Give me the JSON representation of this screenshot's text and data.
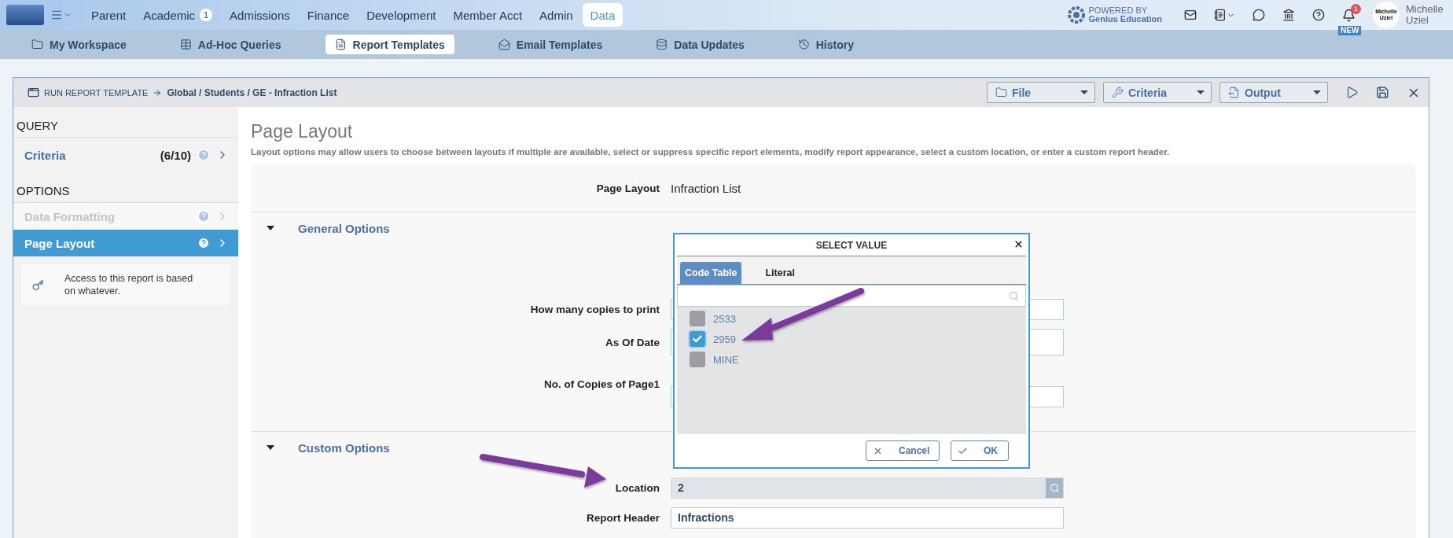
{
  "top_nav": {
    "menu": [
      {
        "label": "Parent",
        "selected": false
      },
      {
        "label": "Academic",
        "badge": "1",
        "selected": false
      },
      {
        "label": "Admissions",
        "selected": false
      },
      {
        "label": "Finance",
        "selected": false
      },
      {
        "label": "Development",
        "selected": false
      },
      {
        "label": "Member Acct",
        "selected": false
      },
      {
        "label": "Admin",
        "selected": false
      },
      {
        "label": "Data",
        "selected": true
      }
    ],
    "powered_by": "POWERED BY",
    "brand": "Genius Education",
    "notification_count": "1",
    "new_badge": "NEW",
    "avatar_lines": [
      "Michelle",
      "Uziel"
    ],
    "user_lines": [
      "Michelle",
      "Uziel"
    ]
  },
  "sub_nav": [
    {
      "label": "My Workspace",
      "selected": false
    },
    {
      "label": "Ad-Hoc Queries",
      "selected": false
    },
    {
      "label": "Report Templates",
      "selected": true
    },
    {
      "label": "Email Templates",
      "selected": false
    },
    {
      "label": "Data Updates",
      "selected": false
    },
    {
      "label": "History",
      "selected": false
    }
  ],
  "panel": {
    "prefix": "RUN REPORT TEMPLATE",
    "path": "Global / Students / GE - Infraction List",
    "menus": [
      {
        "label": "File"
      },
      {
        "label": "Criteria"
      },
      {
        "label": "Output"
      }
    ]
  },
  "sidebar": {
    "sections": [
      {
        "title": "QUERY",
        "items": [
          {
            "label": "Criteria",
            "count": "(6/10)",
            "disabled": false,
            "selected": false
          }
        ]
      },
      {
        "title": "OPTIONS",
        "items": [
          {
            "label": "Data Formatting",
            "disabled": true,
            "selected": false
          },
          {
            "label": "Page Layout",
            "disabled": false,
            "selected": true
          }
        ]
      }
    ],
    "note": "Access to this report is based on whatever."
  },
  "content": {
    "title": "Page Layout",
    "description": "Layout options may allow users to choose between layouts if multiple are available, select or suppress specific report elements, modify report appearance, select a custom location, or enter a custom report header.",
    "page_layout": {
      "label": "Page Layout",
      "value": "Infraction List"
    },
    "sections": [
      {
        "title": "General Options",
        "expanded": true,
        "fields": [
          {
            "label": "How many copies to print",
            "kind": "text"
          },
          {
            "label": "As Of Date",
            "kind": "date"
          },
          {
            "label": "No. of Copies of Page1",
            "kind": "text"
          }
        ]
      },
      {
        "title": "Custom Options",
        "expanded": true,
        "fields": [
          {
            "label": "Location",
            "kind": "lookup",
            "value": "2"
          },
          {
            "label": "Report Header",
            "kind": "text",
            "value": "Infractions"
          }
        ]
      }
    ]
  },
  "dialog": {
    "title": "SELECT VALUE",
    "tabs": [
      {
        "label": "Code Table",
        "selected": true
      },
      {
        "label": "Literal",
        "selected": false
      }
    ],
    "options": [
      {
        "label": "2533",
        "checked": false
      },
      {
        "label": "2959",
        "checked": true
      },
      {
        "label": "MINE",
        "checked": false
      }
    ],
    "buttons": [
      {
        "label": "Cancel",
        "kind": "cancel"
      },
      {
        "label": "OK",
        "kind": "ok"
      }
    ]
  }
}
